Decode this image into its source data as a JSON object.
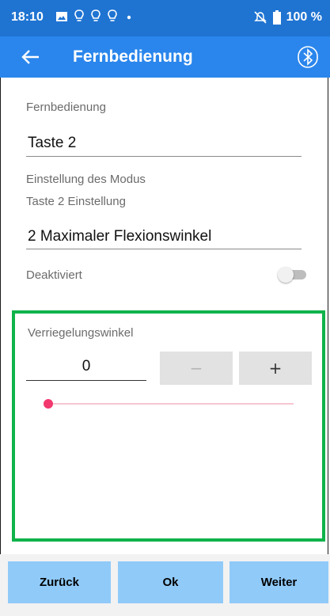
{
  "status_bar": {
    "time": "18:10",
    "battery": "100 %",
    "icons": [
      "image-icon",
      "notification-icon",
      "notification-icon",
      "notification-icon",
      "dot-icon"
    ],
    "right_icons": [
      "mute-icon",
      "battery-icon"
    ]
  },
  "toolbar": {
    "title": "Fernbedienung",
    "back_icon": "arrow-left-icon",
    "bluetooth_icon": "bluetooth-icon"
  },
  "form": {
    "remote_label": "Fernbedienung",
    "remote_value": "Taste 2",
    "mode_label": "Einstellung des Modus",
    "button_setting_label": "Taste 2 Einstellung",
    "mode_value": "2 Maximaler Flexionswinkel",
    "toggle_label": "Deaktiviert",
    "toggle_on": false
  },
  "lock_panel": {
    "label": "Verriegelungswinkel",
    "value": "0",
    "minus_label": "−",
    "plus_label": "+",
    "slider_fraction": 0
  },
  "footer": {
    "back_label": "Zurück",
    "ok_label": "Ok",
    "next_label": "Weiter"
  },
  "colors": {
    "status_bar": "#1f74d2",
    "toolbar": "#2a86ec",
    "highlight_border": "#0fb34a",
    "slider_thumb": "#f2386e",
    "footer_button": "#90caf9"
  }
}
